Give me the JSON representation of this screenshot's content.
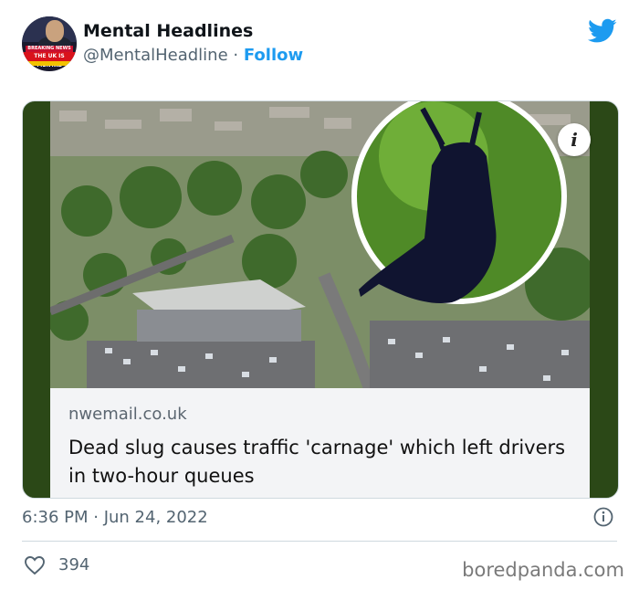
{
  "tweet": {
    "display_name": "Mental Headlines",
    "handle": "@MentalHeadline",
    "separator": "·",
    "follow_label": "Follow",
    "timestamp": "6:36 PM · Jun 24, 2022",
    "like_count": "394"
  },
  "avatar": {
    "banner_text": "BREAKING NEWS",
    "ticker_text": "THE UK IS MENTAL"
  },
  "card": {
    "source": "nwemail.co.uk",
    "headline": "Dead slug causes traffic 'carnage' which left drivers in two-hour queues",
    "info_glyph": "i"
  },
  "watermark": "boredpanda.com",
  "colors": {
    "accent": "#1d9bf0",
    "card_border": "#2b4817"
  }
}
